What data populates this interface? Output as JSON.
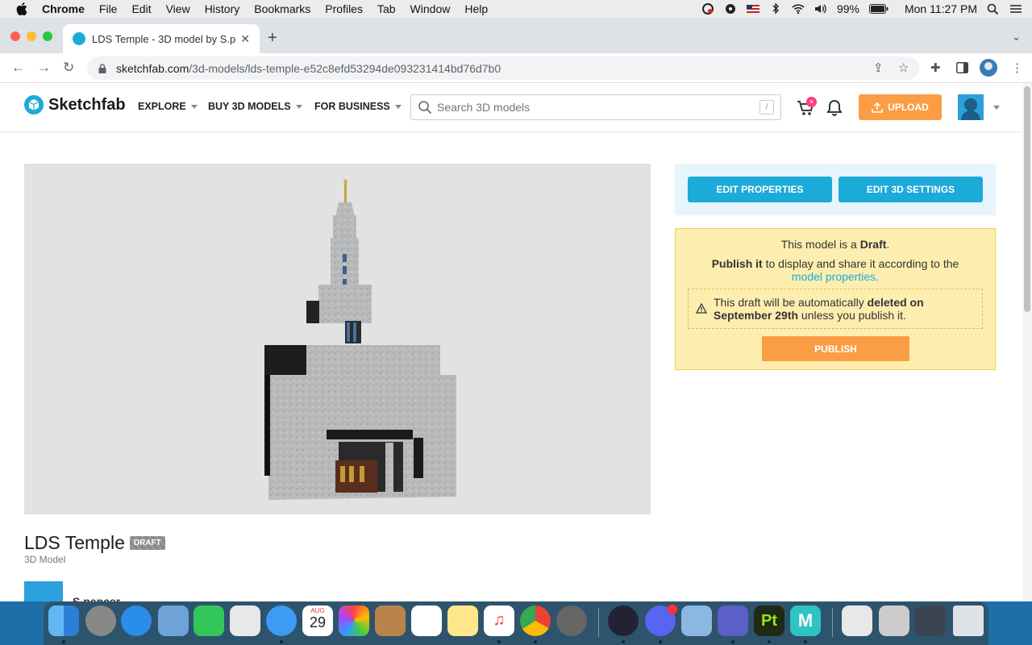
{
  "menubar": {
    "app": "Chrome",
    "items": [
      "File",
      "Edit",
      "View",
      "History",
      "Bookmarks",
      "Profiles",
      "Tab",
      "Window",
      "Help"
    ],
    "battery": "99%",
    "clock": "Mon 11:27 PM"
  },
  "browser": {
    "tab_title": "LDS Temple - 3D model by S.p",
    "url_domain": "sketchfab.com",
    "url_path": "/3d-models/lds-temple-e52c8efd53294de093231414bd76d7b0"
  },
  "header": {
    "logo": "Sketchfab",
    "nav": [
      "EXPLORE",
      "BUY 3D MODELS",
      "FOR BUSINESS"
    ],
    "search_placeholder": "Search 3D models",
    "search_shortcut": "/",
    "upload_label": "UPLOAD"
  },
  "edit": {
    "properties_label": "EDIT PROPERTIES",
    "settings_label": "EDIT 3D SETTINGS"
  },
  "draft": {
    "line1_pre": "This model is a ",
    "line1_bold": "Draft",
    "line1_post": ".",
    "line2_bold": "Publish it",
    "line2_mid": " to display and share it according to the",
    "line2_link": "model properties.",
    "warn_pre": "This draft will be automatically ",
    "warn_bold": "deleted on September 29th",
    "warn_post": " unless you publish it.",
    "publish_label": "PUBLISH"
  },
  "model": {
    "title": "LDS Temple",
    "badge": "DRAFT",
    "subtitle": "3D Model",
    "author": "S.pencer"
  },
  "dock": {
    "calendar_month": "AUG",
    "calendar_day": "29"
  }
}
